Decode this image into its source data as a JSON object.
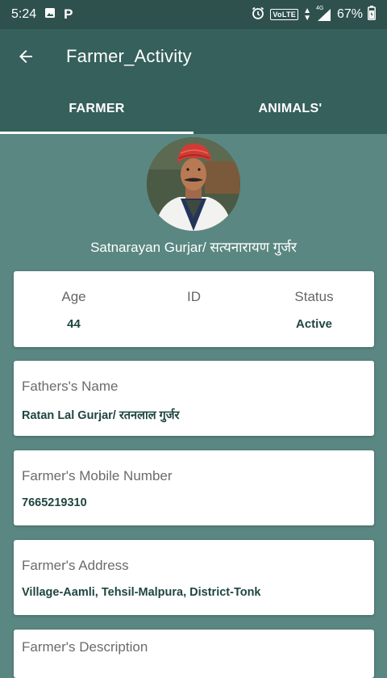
{
  "status_bar": {
    "time": "5:24",
    "left_icons": [
      "image-icon",
      "parking-p-icon"
    ],
    "network_label": "VoLTE",
    "network_type": "4G",
    "battery": "67%"
  },
  "app_bar": {
    "title": "Farmer_Activity",
    "back_icon": "arrow-back-icon"
  },
  "tabs": [
    {
      "label": "FARMER",
      "selected": true
    },
    {
      "label": "ANIMALS'",
      "selected": false
    }
  ],
  "profile": {
    "name": "Satnarayan Gurjar/ सत्यनारायण गुर्जर"
  },
  "stats": {
    "age_label": "Age",
    "age_value": "44",
    "id_label": "ID",
    "id_value": "",
    "status_label": "Status",
    "status_value": "Active"
  },
  "details": {
    "father_label": "Fathers's Name",
    "father_value": "Ratan Lal Gurjar/ रतनलाल गुर्जर",
    "mobile_label": "Farmer's Mobile Number",
    "mobile_value": "7665219310",
    "address_label": "Farmer's Address",
    "address_value": "Village-Aamli, Tehsil-Malpura, District-Tonk",
    "description_label": "Farmer's Description"
  },
  "colors": {
    "status_bar": "#2e514e",
    "app_bar": "#35605b",
    "background": "#5a8782",
    "value_text": "#1f4540"
  }
}
